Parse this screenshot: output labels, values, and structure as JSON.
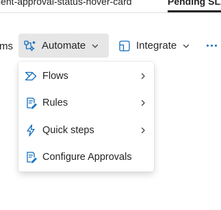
{
  "tabs": {
    "left_label": "ient-approval-status-hover-card",
    "right_label": "Pending SLA"
  },
  "command_bar": {
    "partial_label": "ms",
    "automate": {
      "label": "Automate",
      "icon": "automate-icon",
      "expanded": true
    },
    "integrate": {
      "label": "Integrate",
      "icon": "integrate-icon"
    },
    "more": {
      "icon": "more-ellipsis-icon"
    }
  },
  "automate_menu": {
    "items": [
      {
        "label": "Flows",
        "icon": "flows-icon",
        "has_submenu": true
      },
      {
        "label": "Rules",
        "icon": "rules-icon",
        "has_submenu": true
      },
      {
        "label": "Quick steps",
        "icon": "quick-steps-icon",
        "has_submenu": true
      },
      {
        "label": "Configure Approvals",
        "icon": "configure-approvals-icon",
        "has_submenu": false
      }
    ]
  },
  "colors": {
    "accent": "#0f6cbd",
    "selected_button_bg": "#e6e6e6",
    "text": "#242424"
  }
}
